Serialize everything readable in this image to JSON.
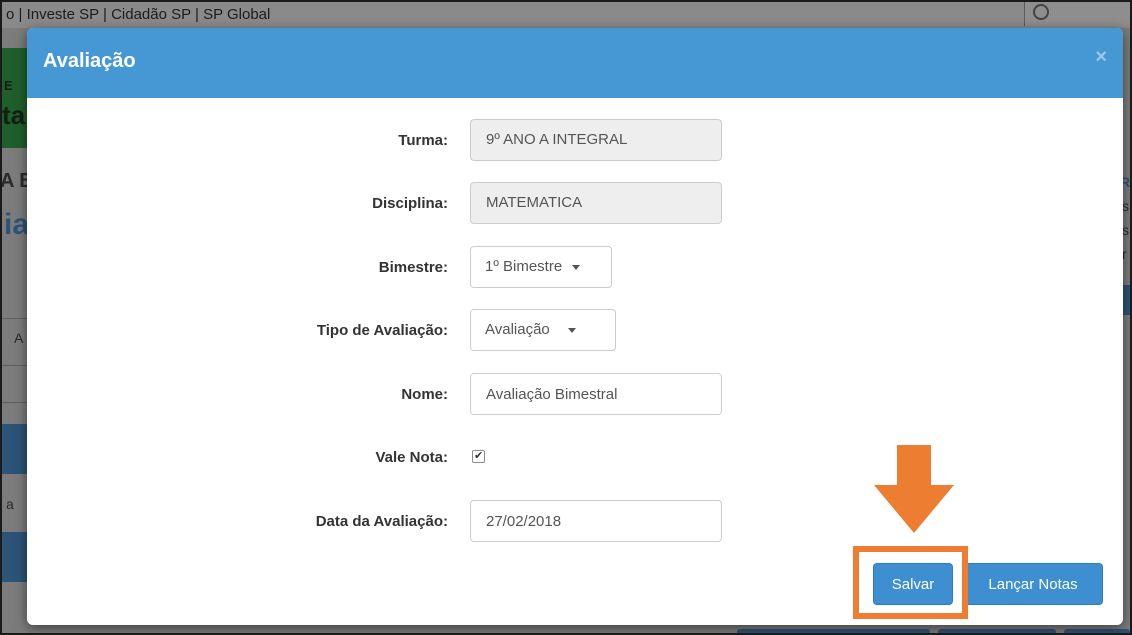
{
  "background": {
    "topbar_text": "o | Investe SP | Cidadão SP | SP Global",
    "fragments": [
      "E",
      "ta",
      "A B",
      "ia",
      "A",
      "a",
      "R",
      "s",
      "s",
      "r"
    ]
  },
  "modal": {
    "title": "Avaliação",
    "close_label": "×",
    "fields": {
      "turma": {
        "label": "Turma:",
        "value": "9º ANO A INTEGRAL"
      },
      "disciplina": {
        "label": "Disciplina:",
        "value": "MATEMATICA"
      },
      "bimestre": {
        "label": "Bimestre:",
        "value": "1º Bimestre"
      },
      "tipo": {
        "label": "Tipo de Avaliação:",
        "value": "Avaliação"
      },
      "nome": {
        "label": "Nome:",
        "value": "Avaliação Bimestral"
      },
      "vale_nota": {
        "label": "Vale Nota:",
        "checked": true
      },
      "data": {
        "label": "Data da Avaliação:",
        "value": "27/02/2018"
      }
    },
    "buttons": {
      "save": "Salvar",
      "grades": "Lançar Notas"
    }
  },
  "colors": {
    "header": "#4598d4",
    "button": "#3d8fd1",
    "annotation": "#ed7d31"
  }
}
